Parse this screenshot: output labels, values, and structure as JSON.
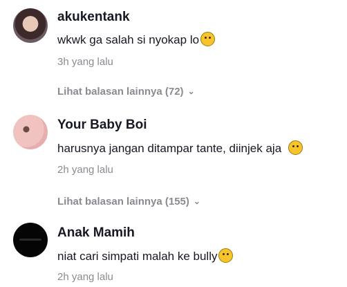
{
  "comments": [
    {
      "username": "akukentank",
      "text": "wkwk ga salah si nyokap lo",
      "emoji_icon": "joy-emoji-icon",
      "time": "3h yang lalu",
      "more_replies": "Lihat balasan lainnya (72)"
    },
    {
      "username": "Your Baby Boi",
      "text": "harusnya jangan ditampar tante, diinjek aja",
      "emoji_icon": "slightly-frowning-emoji-icon",
      "time": "2h yang lalu",
      "more_replies": "Lihat balasan lainnya (155)"
    },
    {
      "username": "Anak Mamih",
      "text": "niat cari simpati malah ke bully",
      "emoji_icon": "pensive-emoji-icon",
      "time": "2h yang lalu"
    }
  ],
  "colors": {
    "text": "#161823",
    "muted": "#8a8b91",
    "emoji": "#f7c42b"
  }
}
